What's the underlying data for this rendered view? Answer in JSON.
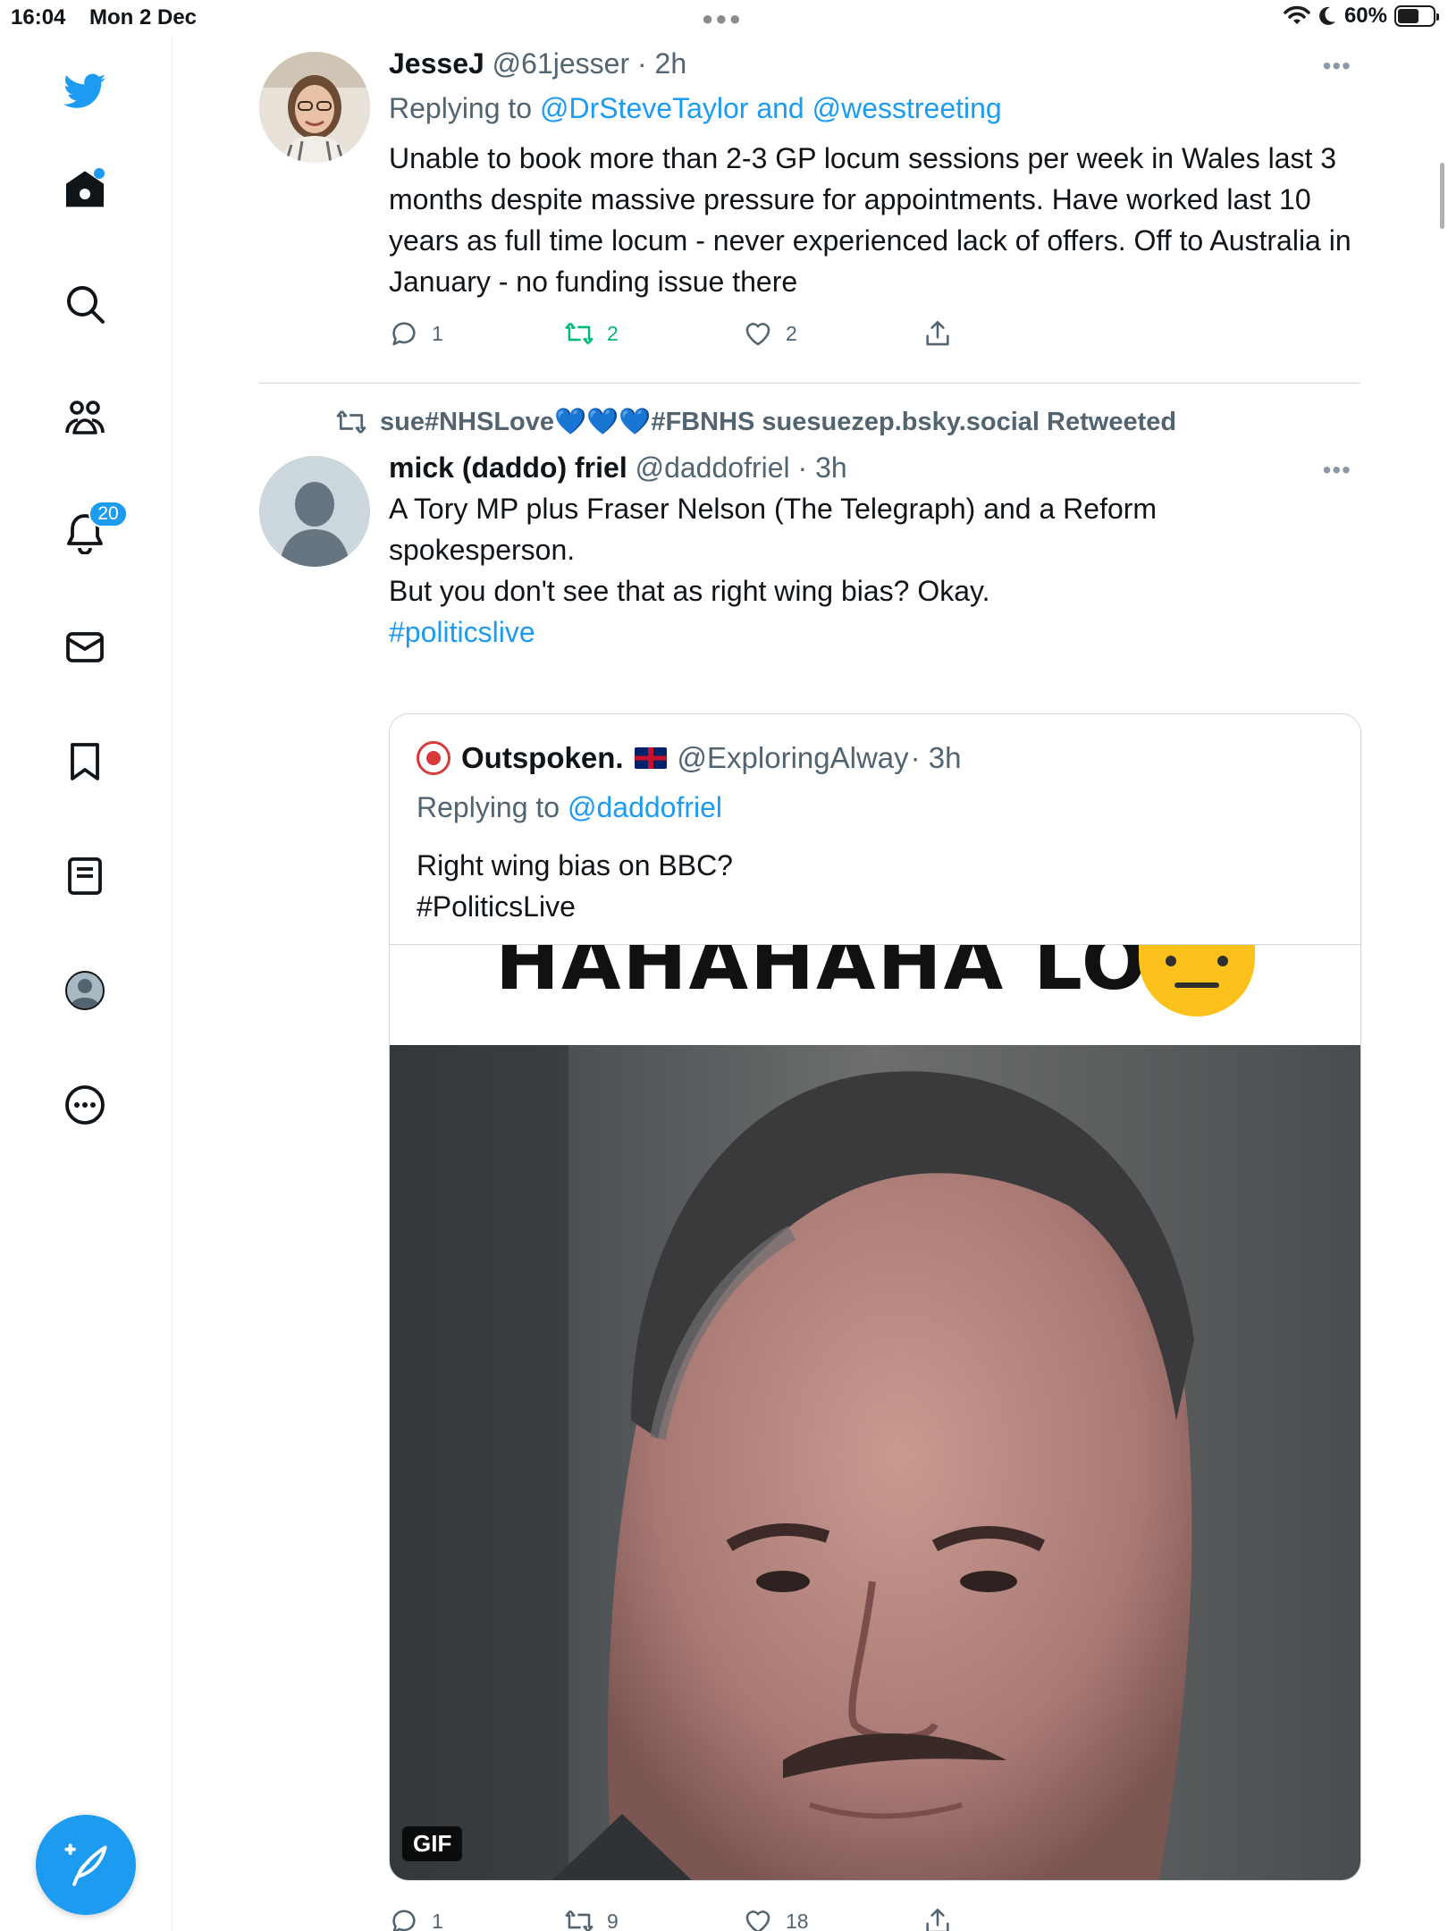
{
  "status_bar": {
    "time": "16:04",
    "date": "Mon 2 Dec",
    "battery": "60%",
    "battery_level": 0.6
  },
  "sidebar": {
    "items": [
      {
        "name": "twitter-logo",
        "icon": "bird-icon"
      },
      {
        "name": "home",
        "icon": "home-icon"
      },
      {
        "name": "explore",
        "icon": "search-icon"
      },
      {
        "name": "communities",
        "icon": "communities-icon"
      },
      {
        "name": "notifications",
        "icon": "bell-icon",
        "badge": "20"
      },
      {
        "name": "messages",
        "icon": "mail-icon"
      },
      {
        "name": "bookmarks",
        "icon": "bookmark-icon"
      },
      {
        "name": "lists",
        "icon": "list-icon"
      },
      {
        "name": "profile",
        "icon": "avatar-icon"
      },
      {
        "name": "more",
        "icon": "more-circle-icon"
      }
    ],
    "accent": "#1d9bf0"
  },
  "tweets": [
    {
      "display_name": "JesseJ",
      "handle": "@61jesser",
      "time": "· 2h",
      "replying_prefix": "Replying to ",
      "replying_to": "@DrSteveTaylor and @wesstreeting",
      "text": "Unable to book more than 2-3 GP locum sessions per week in Wales last 3 months despite massive pressure for appointments. Have worked last 10 years as full time locum - never experienced lack of offers. Off to Australia in January - no funding issue there",
      "replies": "1",
      "retweets": "2",
      "likes": "2"
    },
    {
      "retweeted_by": "sue#NHSLove💙💙💙#FBNHS suesuezep.bsky.social Retweeted",
      "display_name": "mick (daddo) friel",
      "handle": "@daddofriel",
      "time": "· 3h",
      "text_lines": [
        "A Tory MP plus Fraser Nelson (The Telegraph) and a Reform",
        "spokesperson.",
        "But you don't see that as right wing bias?  Okay."
      ],
      "hashtag": "#politicslive",
      "quote": {
        "display_name": "Outspoken.",
        "handle": "@ExploringAlway",
        "time": "· 3h",
        "replying_prefix": "Replying to ",
        "replying_to": "@daddofriel",
        "text_lines": [
          "Right wing bias on BBC?",
          "#PoliticsLive"
        ],
        "media_caption": "HAHAHAHA LOL!",
        "media_badge": "GIF"
      },
      "replies": "1",
      "retweets": "9",
      "likes": "18"
    }
  ]
}
